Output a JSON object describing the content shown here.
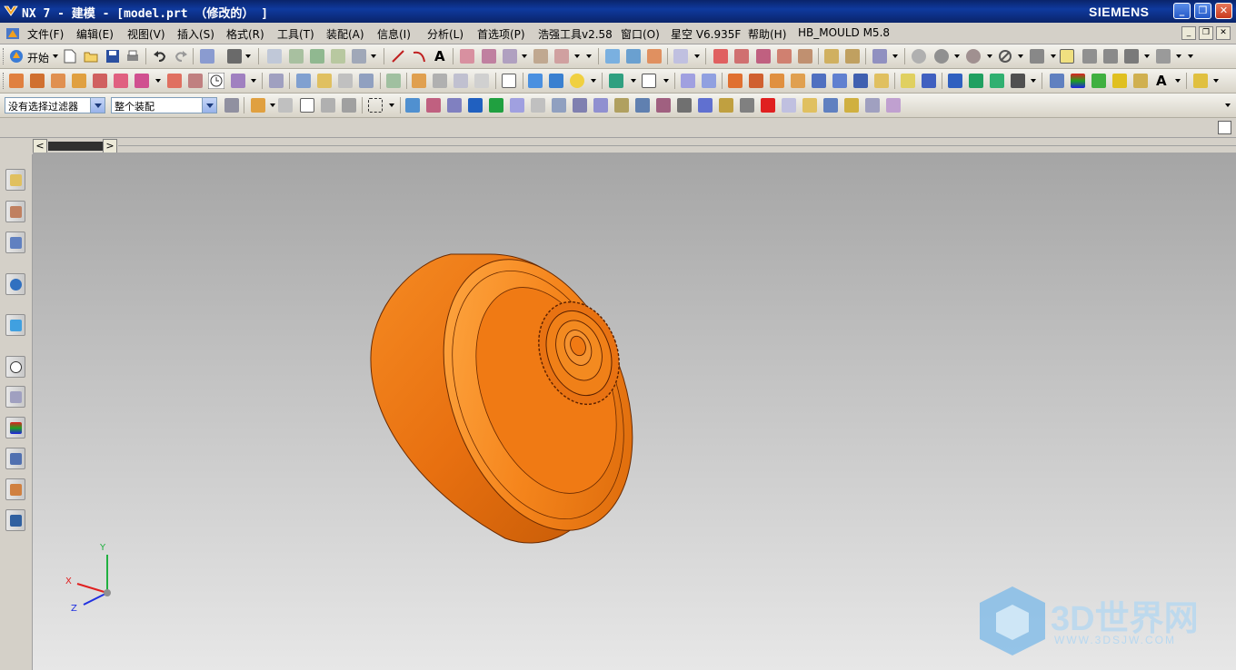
{
  "window": {
    "title": "NX 7 - 建模 - [model.prt （修改的） ]",
    "brand": "SIEMENS",
    "buttons": [
      "_",
      "❐",
      "✕"
    ]
  },
  "menu": {
    "items": [
      "文件(F)",
      "编辑(E)",
      "视图(V)",
      "插入(S)",
      "格式(R)",
      "工具(T)",
      "装配(A)",
      "信息(I)",
      "分析(L)",
      "首选项(P)",
      "浩强工具v2.58",
      "窗口(O)",
      "星空 V6.935F",
      "帮助(H)",
      "HB_MOULD M5.8"
    ],
    "mdi_buttons": [
      "_",
      "❐",
      "✕"
    ]
  },
  "toolbar1": {
    "start_label": "开始"
  },
  "toolbar3": {
    "selection_filter": "没有选择过滤器",
    "scope": "整个装配"
  },
  "axes": {
    "x": "X",
    "y": "Y",
    "z": "Z"
  },
  "watermark": {
    "logo": "3D世界网",
    "url": "WWW.3DSJW.COM"
  },
  "colors": {
    "title_bg": "#0a246a",
    "part_orange": "#f07a14",
    "viewport_top": "#a5a5a5",
    "viewport_bottom": "#e7e7e7",
    "axis_x": "#e02020",
    "axis_y": "#20b040",
    "axis_z": "#2030e0"
  }
}
